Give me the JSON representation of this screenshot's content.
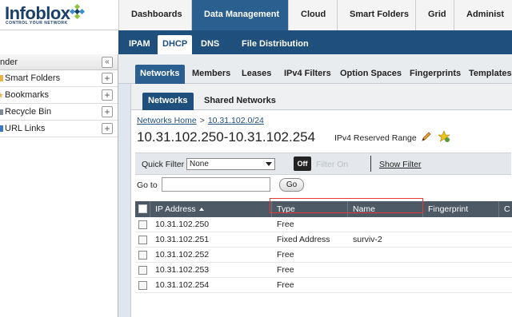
{
  "app": {
    "logo_text": "Infoblox",
    "logo_tagline": "CONTROL YOUR NETWORK",
    "main_tabs": [
      {
        "label": "Dashboards"
      },
      {
        "label": "Data Management"
      },
      {
        "label": "Cloud"
      },
      {
        "label": "Smart Folders"
      },
      {
        "label": "Grid"
      },
      {
        "label": "Administ"
      }
    ],
    "sub_tabs": [
      {
        "label": "IPAM"
      },
      {
        "label": "DHCP"
      },
      {
        "label": "DNS"
      },
      {
        "label": "File Distribution"
      }
    ]
  },
  "left_panel": {
    "header": "nder",
    "collapse_label": "«",
    "items": [
      {
        "label": "Smart Folders"
      },
      {
        "label": "Bookmarks"
      },
      {
        "label": "Recycle Bin"
      },
      {
        "label": "URL Links"
      }
    ],
    "add_label": "+"
  },
  "dhcp_tabs": [
    {
      "label": "Networks"
    },
    {
      "label": "Members"
    },
    {
      "label": "Leases"
    },
    {
      "label": "IPv4 Filters"
    },
    {
      "label": "Option Spaces"
    },
    {
      "label": "Fingerprints"
    },
    {
      "label": "Templates"
    }
  ],
  "network_tabs": [
    {
      "label": "Networks"
    },
    {
      "label": "Shared Networks"
    }
  ],
  "breadcrumb": {
    "home": "Networks Home",
    "sep": ">",
    "network": "10.31.102.0/24"
  },
  "range": {
    "title": "10.31.102.250-10.31.102.254",
    "type": "IPv4 Reserved Range"
  },
  "filter": {
    "label": "Quick Filter",
    "selected": "None",
    "off_label": "Off",
    "filter_on_label": "Filter On",
    "show_filter_label": "Show Filter"
  },
  "goto": {
    "label": "Go to",
    "value": "",
    "button": "Go"
  },
  "table": {
    "columns": [
      "IP Address",
      "Type",
      "Name",
      "Fingerprint",
      "C"
    ],
    "rows": [
      {
        "ip": "10.31.102.250",
        "type": "Free",
        "name": ""
      },
      {
        "ip": "10.31.102.251",
        "type": "Fixed Address",
        "name": "surviv-2"
      },
      {
        "ip": "10.31.102.252",
        "type": "Free",
        "name": ""
      },
      {
        "ip": "10.31.102.253",
        "type": "Free",
        "name": ""
      },
      {
        "ip": "10.31.102.254",
        "type": "Free",
        "name": ""
      }
    ]
  },
  "colors": {
    "active_tab": "#2a5f8f",
    "subnav": "#1f4f7c",
    "grid_header": "#4d5965",
    "highlight": "#e53935"
  }
}
